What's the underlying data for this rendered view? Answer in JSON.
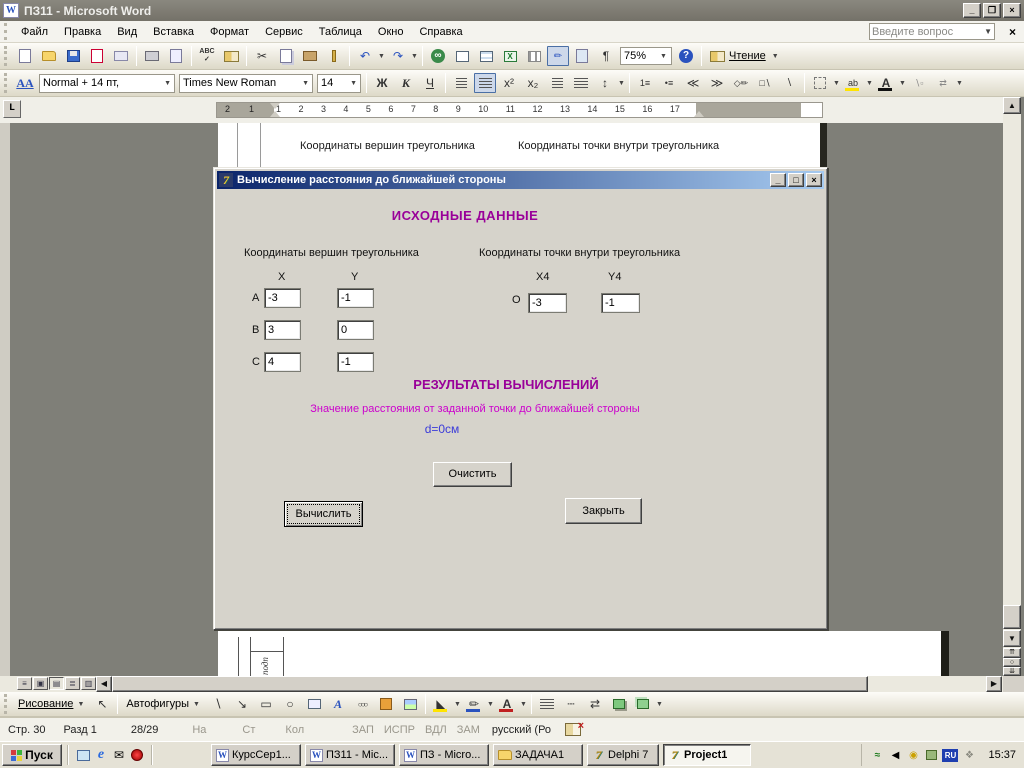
{
  "window": {
    "title": "ПЗ11 - Microsoft Word",
    "question_placeholder": "Введите вопрос"
  },
  "menus": [
    "Файл",
    "Правка",
    "Вид",
    "Вставка",
    "Формат",
    "Сервис",
    "Таблица",
    "Окно",
    "Справка"
  ],
  "standard_toolbar": {
    "zoom": "75%",
    "reading": "Чтение"
  },
  "formatting_toolbar": {
    "style": "Normal + 14 пт,",
    "font": "Times New Roman",
    "size": "14",
    "bold": "Ж",
    "italic": "К",
    "underline": "Ч",
    "sup": "x²",
    "sub": "x₂"
  },
  "ruler": {
    "left_numbers": [
      "2",
      "1"
    ],
    "numbers": [
      "1",
      "2",
      "3",
      "4",
      "5",
      "6",
      "7",
      "8",
      "9",
      "10",
      "11",
      "12",
      "13",
      "14",
      "15",
      "16",
      "17"
    ]
  },
  "document": {
    "header_left": "Координаты вершин треугольника",
    "header_right": "Координаты точки внутри треугольника",
    "frame_label": "подп"
  },
  "dialog": {
    "title": "Вычисление расстояния до ближайшей стороны",
    "heading_input": "ИСХОДНЫЕ ДАННЫЕ",
    "group_left": "Координаты вершин треугольника",
    "group_right": "Координаты точки внутри треугольника",
    "col_x": "X",
    "col_y": "Y",
    "col_x4": "X4",
    "col_y4": "Y4",
    "rows": [
      {
        "label": "А",
        "x": "-3",
        "y": "-1"
      },
      {
        "label": "В",
        "x": "3",
        "y": "0"
      },
      {
        "label": "С",
        "x": "4",
        "y": "-1"
      }
    ],
    "point": {
      "label": "О",
      "x": "-3",
      "y": "-1"
    },
    "heading_result": "РЕЗУЛЬТАТЫ ВЫЧИСЛЕНИЙ",
    "result_caption": "Значение расстояния от заданной точки до ближайшей стороны",
    "result_value": "d=0см",
    "buttons": {
      "clear": "Очистить",
      "calc": "Вычислить",
      "close": "Закрыть"
    }
  },
  "drawing_toolbar": {
    "draw": "Рисование",
    "autoshapes": "Автофигуры"
  },
  "status_bar": {
    "page": "Стр. 30",
    "section": "Разд 1",
    "pages": "28/29",
    "at": "На",
    "line": "Ст",
    "col": "Кол",
    "rec": "ЗАП",
    "rev": "ИСПР",
    "ext": "ВДЛ",
    "ovr": "ЗАМ",
    "lang": "русский (Ро"
  },
  "taskbar": {
    "start": "Пуск",
    "buttons": [
      {
        "label": "КурсСер1..."
      },
      {
        "label": "ПЗ11 - Mic..."
      },
      {
        "label": "ПЗ - Micro..."
      },
      {
        "label": "ЗАДАЧА1"
      },
      {
        "label": "Delphi 7"
      },
      {
        "label": "Project1"
      }
    ],
    "lang_indicator": "RU",
    "time": "15:37"
  }
}
